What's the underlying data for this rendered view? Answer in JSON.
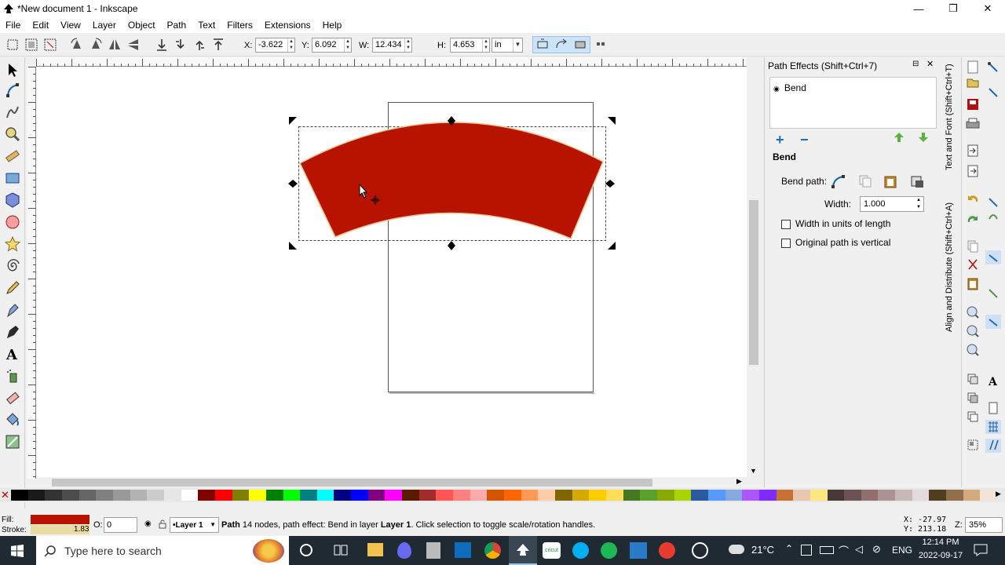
{
  "window": {
    "title": "*New document 1 - Inkscape",
    "minimize": "—",
    "restore": "❐",
    "close": "✕"
  },
  "menu": [
    "File",
    "Edit",
    "View",
    "Layer",
    "Object",
    "Path",
    "Text",
    "Filters",
    "Extensions",
    "Help"
  ],
  "toolbar": {
    "x_label": "X:",
    "x_value": "-3.622",
    "y_label": "Y:",
    "y_value": "6.092",
    "w_label": "W:",
    "w_value": "12.434",
    "h_label": "H:",
    "h_value": "4.653",
    "unit": "in"
  },
  "panel": {
    "title": "Path Effects  (Shift+Ctrl+7)",
    "effect_item": "Bend",
    "section_title": "Bend",
    "bend_path_label": "Bend path:",
    "width_label": "Width:",
    "width_value": "1.000",
    "checkbox1": "Width in units of length",
    "checkbox2": "Original path is vertical"
  },
  "side_tabs": {
    "tab1": "Text and Font (Shift+Ctrl+T)",
    "tab2": "Align and Distribute (Shift+Ctrl+A)"
  },
  "status": {
    "fill_label": "Fill:",
    "stroke_label": "Stroke:",
    "stroke_width": "1.83",
    "opacity_label": "O:",
    "opacity_value": "0",
    "layer": "•Layer 1",
    "message_bold": "Path",
    "message": " 14 nodes, path effect: Bend in layer ",
    "message_layer": "Layer 1",
    "message_end": ". Click selection to toggle scale/rotation handles.",
    "x_coord": "X: -27.97",
    "y_coord": "Y: 213.18",
    "z_label": "Z:",
    "zoom": "35%"
  },
  "taskbar": {
    "search_placeholder": "Type here to search",
    "weather": "21°C",
    "lang": "ENG",
    "time": "12:14 PM",
    "date": "2022-09-17"
  },
  "colors": {
    "shape_fill": "#b81300",
    "accent": "#0078d7",
    "taskbar": "#1f2a33"
  },
  "palette": [
    "#000000",
    "#1a1a1a",
    "#333333",
    "#4d4d4d",
    "#666666",
    "#808080",
    "#999999",
    "#b3b3b3",
    "#cccccc",
    "#e6e6e6",
    "#ffffff",
    "#800000",
    "#ff0000",
    "#808000",
    "#ffff00",
    "#008000",
    "#00ff00",
    "#008080",
    "#00ffff",
    "#000080",
    "#0000ff",
    "#800080",
    "#ff00ff",
    "#5a1a00",
    "#a02c2c",
    "#ff5555",
    "#ff8080",
    "#ffaaaa",
    "#d45500",
    "#ff6600",
    "#ff9955",
    "#ffccaa",
    "#806600",
    "#d4aa00",
    "#ffcc00",
    "#ffdd55",
    "#447821",
    "#5aa02c",
    "#88aa00",
    "#aad400",
    "#2c5aa0",
    "#5599ff",
    "#87aade",
    "#ad56ff",
    "#7f2aff",
    "#c87137",
    "#e9c6af",
    "#ffe680",
    "#483737",
    "#6c5353",
    "#916f6f",
    "#ac9393",
    "#c8b7b7",
    "#e3dbdb",
    "#503e1f",
    "#916f4a",
    "#d4aa7d",
    "#f4e3d7"
  ]
}
